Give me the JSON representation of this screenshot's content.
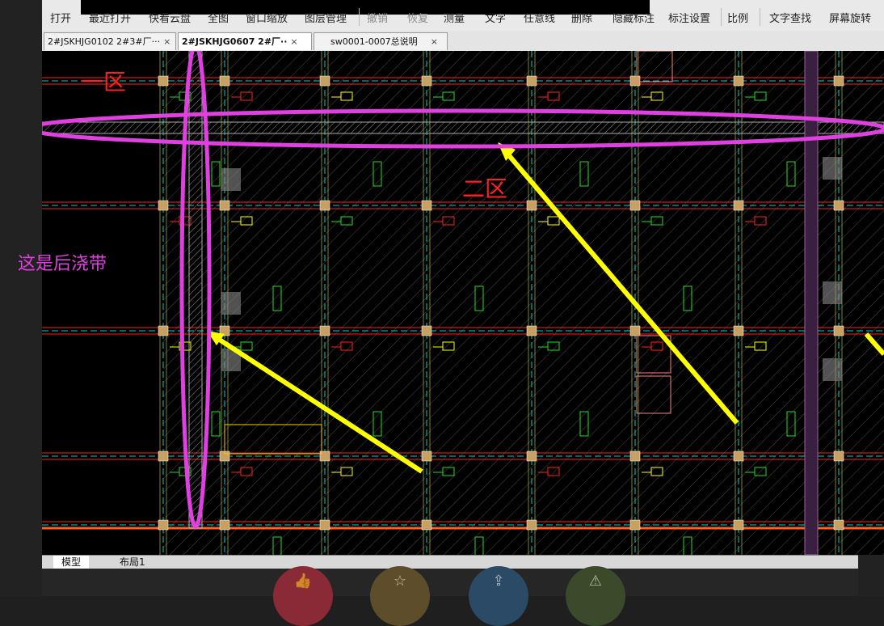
{
  "menu": [
    "打开",
    "最近打开",
    "快看云盘",
    "全图",
    "窗口缩放",
    "图层管理",
    "撤销",
    "恢复",
    "测量",
    "文字",
    "任意线",
    "删除",
    "隐藏标注",
    "标注设置",
    "比例",
    "文字查找",
    "屏幕旋转"
  ],
  "tabs": [
    {
      "label": "2#JSKHJG0102 2#3#厂···",
      "active": false
    },
    {
      "label": "2#JSKHJG0607  2#厂··",
      "active": true
    },
    {
      "label": "sw0001-0007总说明",
      "active": false
    }
  ],
  "tab_close": "×",
  "annotation": "这是后浇带",
  "drawing_labels": {
    "zone_1": "一区",
    "zone_2": "二区"
  },
  "layout_tabs": [
    "模型",
    "布局1"
  ],
  "colors": {
    "magenta": "#e040e0",
    "yellow": "#ffff00",
    "cyan": "#00cccc",
    "red": "#ff2020",
    "green": "#20e020",
    "grid": "#404040"
  },
  "bottom_icons": [
    "thumbs-up-icon",
    "star-icon",
    "share-icon",
    "warning-icon"
  ]
}
